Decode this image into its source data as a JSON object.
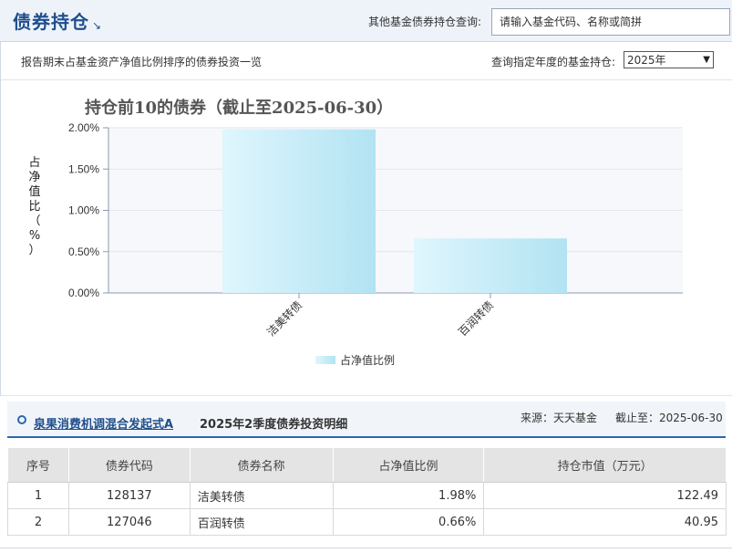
{
  "header": {
    "title": "债券持仓",
    "search_label": "其他基金债券持仓查询:",
    "search_placeholder": "请输入基金代码、名称或简拼"
  },
  "subbar": {
    "description": "报告期末占基金资产净值比例排序的债券投资一览",
    "year_label": "查询指定年度的基金持仓:",
    "year_selected": "2025年"
  },
  "chart_data": {
    "type": "bar",
    "title": "持仓前10的债券（截止至2025-06-30）",
    "ylabel": "占净值比（%）",
    "categories": [
      "洁美转债",
      "百润转债"
    ],
    "series": [
      {
        "name": "占净值比例",
        "values": [
          1.98,
          0.66
        ],
        "color": "#c8eefa"
      }
    ],
    "ylim": [
      0,
      2
    ],
    "yticks": [
      "0.00%",
      "0.50%",
      "1.00%",
      "1.50%",
      "2.00%"
    ],
    "legend_position": "bottom"
  },
  "detail": {
    "fund_name": "泉果消费机调混合发起式A",
    "subject": "2025年2季度债券投资明细",
    "source": "来源：天天基金",
    "asof": "截止至：2025-06-30"
  },
  "table": {
    "headers": [
      "序号",
      "债券代码",
      "债券名称",
      "占净值比例",
      "持仓市值（万元）"
    ],
    "rows": [
      [
        "1",
        "128137",
        "洁美转债",
        "1.98%",
        "122.49"
      ],
      [
        "2",
        "127046",
        "百润转债",
        "0.66%",
        "40.95"
      ]
    ]
  },
  "colors": {
    "brand": "#1f4e8c",
    "bar": "#c8eefa",
    "accent": "#2b67ad"
  }
}
